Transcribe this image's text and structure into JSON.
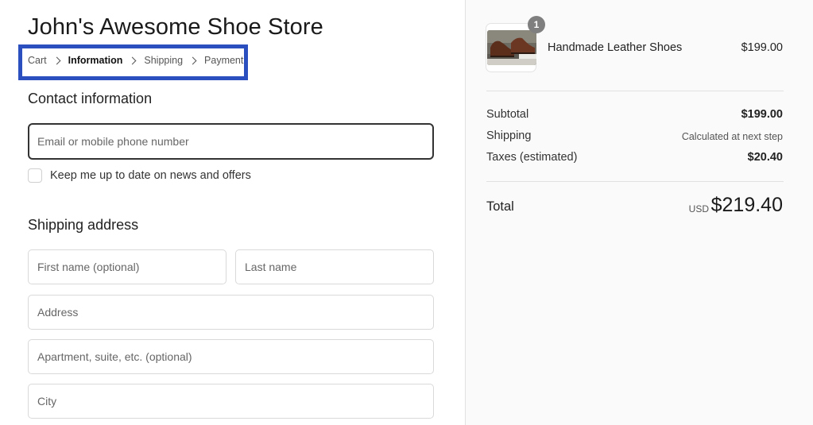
{
  "store": {
    "title": "John's Awesome Shoe Store"
  },
  "breadcrumb": {
    "items": [
      "Cart",
      "Information",
      "Shipping",
      "Payment"
    ],
    "active": "Information",
    "highlight_color": "#2b4fbf"
  },
  "contact": {
    "section_title": "Contact information",
    "email_placeholder": "Email or mobile phone number",
    "email_value": "",
    "newsletter_label": "Keep me up to date on news and offers",
    "newsletter_checked": false
  },
  "shipping_address": {
    "section_title": "Shipping address",
    "first_name_placeholder": "First name (optional)",
    "last_name_placeholder": "Last name",
    "address_placeholder": "Address",
    "apartment_placeholder": "Apartment, suite, etc. (optional)",
    "city_placeholder": "City"
  },
  "order_summary": {
    "item": {
      "name": "Handmade Leather Shoes",
      "price": "$199.00",
      "quantity": "1",
      "thumbnail": "leather-shoes-photo"
    },
    "subtotal_label": "Subtotal",
    "subtotal_value": "$199.00",
    "shipping_label": "Shipping",
    "shipping_value": "Calculated at next step",
    "taxes_label": "Taxes (estimated)",
    "taxes_value": "$20.40",
    "total_label": "Total",
    "total_currency": "USD",
    "total_value": "$219.40"
  }
}
